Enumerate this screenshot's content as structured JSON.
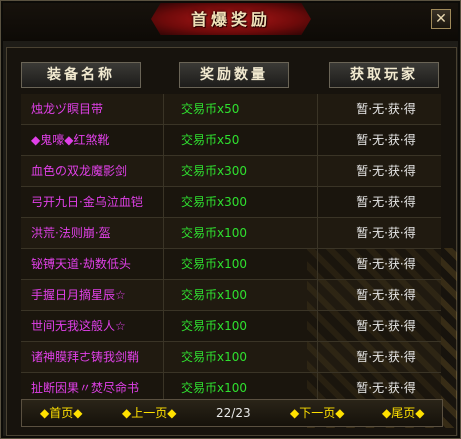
{
  "window": {
    "title": "首爆奖励",
    "close_glyph": "✕"
  },
  "headers": {
    "col1": "装备名称",
    "col2": "奖励数量",
    "col3": "获取玩家"
  },
  "rows": [
    {
      "name": "烛龙ヅ瞑目带",
      "reward": "交易币x50",
      "player": "暂·无·获·得"
    },
    {
      "name": "◆鬼嚎◆红煞靴",
      "reward": "交易币x50",
      "player": "暂·无·获·得"
    },
    {
      "name": "血色の双龙魔影剑",
      "reward": "交易币x300",
      "player": "暂·无·获·得"
    },
    {
      "name": "弓开九日·金乌泣血铠",
      "reward": "交易币x300",
      "player": "暂·无·获·得"
    },
    {
      "name": "洪荒·法则崩·盔",
      "reward": "交易币x100",
      "player": "暂·无·获·得"
    },
    {
      "name": "铋镈天道·劫数低头",
      "reward": "交易币x100",
      "player": "暂·无·获·得"
    },
    {
      "name": "手握日月摘星辰☆",
      "reward": "交易币x100",
      "player": "暂·无·获·得"
    },
    {
      "name": "世间无我这般人☆",
      "reward": "交易币x100",
      "player": "暂·无·获·得"
    },
    {
      "name": "诸神膜拜ㄜ铸我剑鞘",
      "reward": "交易币x100",
      "player": "暂·无·获·得"
    },
    {
      "name": "扯断因果〃焚尽命书",
      "reward": "交易币x100",
      "player": "暂·无·获·得"
    }
  ],
  "pager": {
    "first": "◆首页◆",
    "prev": "◆上一页◆",
    "page": "22/23",
    "next": "◆下一页◆",
    "last": "◆尾页◆"
  },
  "colors": {
    "item_name": "#e040e8",
    "reward": "#2fe02f",
    "player": "#e8e8e8",
    "pager_link": "#ffe100"
  }
}
